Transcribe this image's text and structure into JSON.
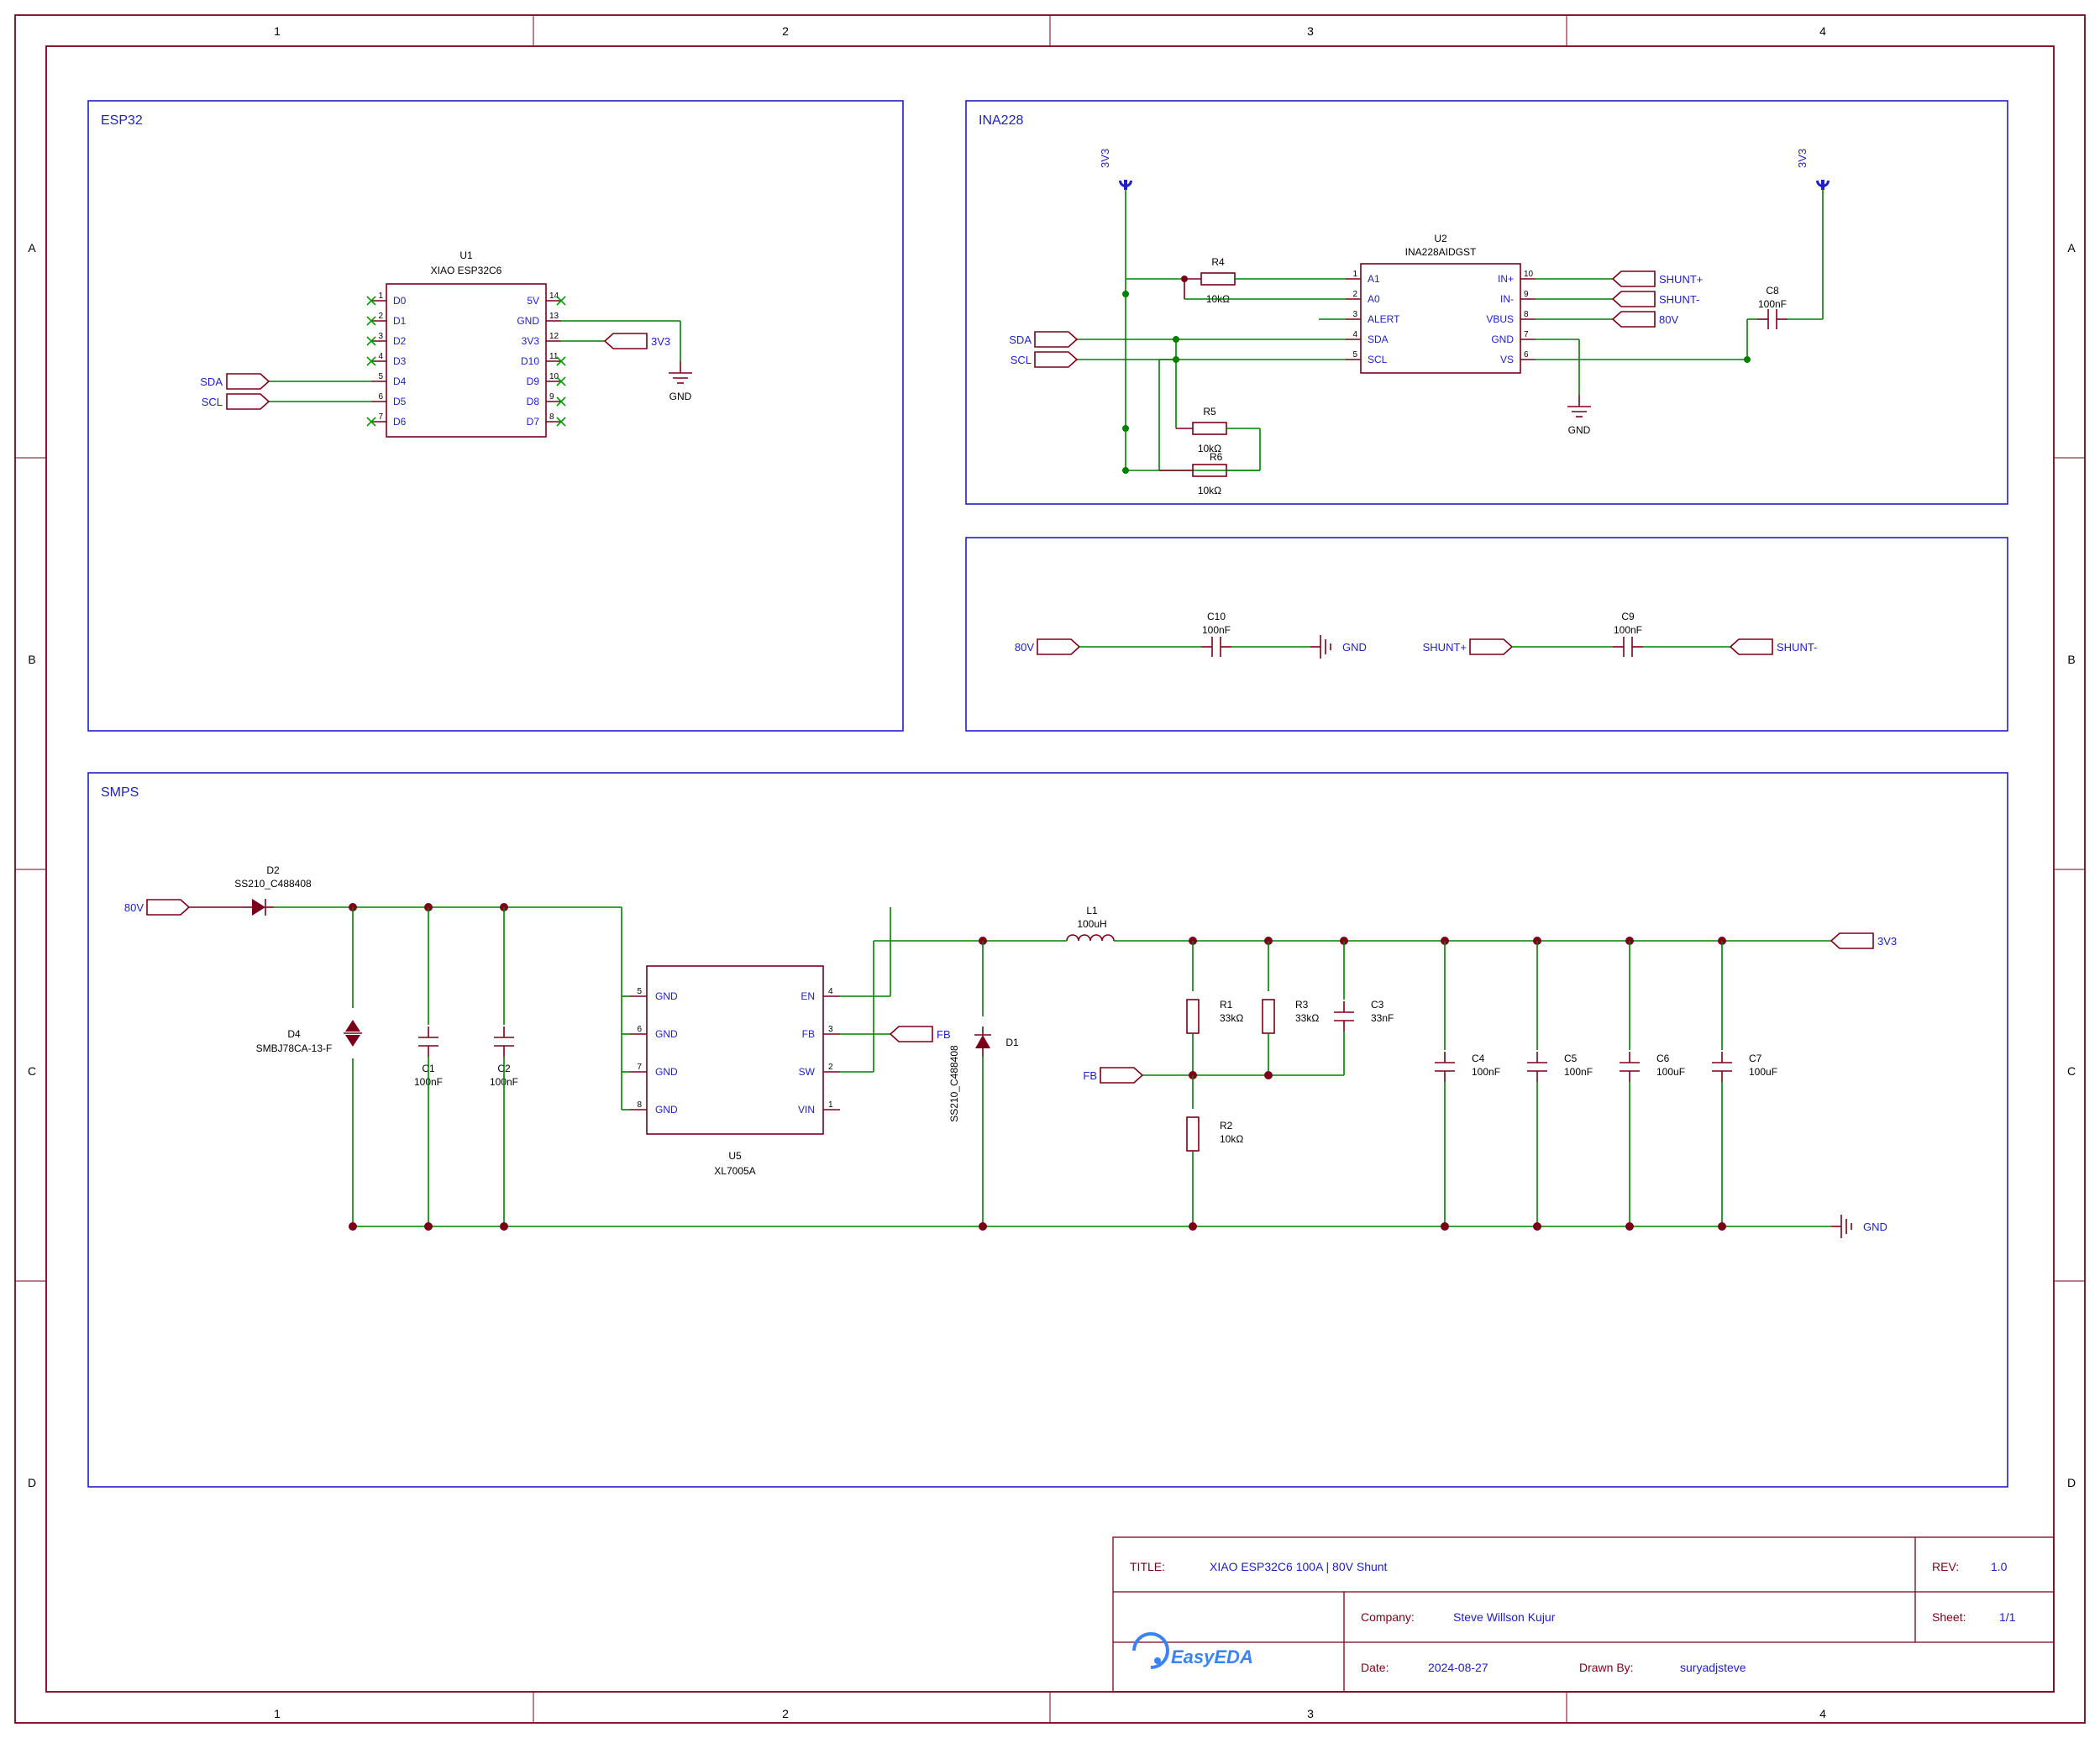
{
  "frame": {
    "cols": [
      "1",
      "2",
      "3",
      "4"
    ],
    "rows": [
      "A",
      "B",
      "C",
      "D"
    ]
  },
  "title_block": {
    "title_label": "TITLE:",
    "title": "XIAO ESP32C6 100A | 80V Shunt",
    "rev_label": "REV:",
    "rev": "1.0",
    "company_label": "Company:",
    "company": "Steve Willson Kujur",
    "sheet_label": "Sheet:",
    "sheet": "1/1",
    "date_label": "Date:",
    "date": "2024-08-27",
    "drawn_by_label": "Drawn By:",
    "drawn_by": "suryadjsteve",
    "logo": "EasyEDA"
  },
  "blocks": {
    "esp32": {
      "title": "ESP32",
      "ref": "U1",
      "part": "XIAO ESP32C6",
      "pins_left": [
        "D0",
        "D1",
        "D2",
        "D3",
        "D4",
        "D5",
        "D6"
      ],
      "pins_right": [
        "5V",
        "GND",
        "3V3",
        "D10",
        "D9",
        "D8",
        "D7"
      ],
      "nets": {
        "sda": "SDA",
        "scl": "SCL",
        "v33": "3V3",
        "gnd": "GND"
      }
    },
    "ina228": {
      "title": "INA228",
      "ref": "U2",
      "part": "INA228AIDGST",
      "pins_left": [
        "A1",
        "A0",
        "ALERT",
        "SDA",
        "SCL"
      ],
      "pins_right": [
        "IN+",
        "IN-",
        "VBUS",
        "GND",
        "VS"
      ],
      "r4": {
        "ref": "R4",
        "val": "10kΩ"
      },
      "r5": {
        "ref": "R5",
        "val": "10kΩ"
      },
      "r6": {
        "ref": "R6",
        "val": "10kΩ"
      },
      "c8": {
        "ref": "C8",
        "val": "100nF"
      },
      "nets": {
        "sda": "SDA",
        "scl": "SCL",
        "v33": "3V3",
        "gnd": "GND",
        "shuntp": "SHUNT+",
        "shuntm": "SHUNT-",
        "v80": "80V"
      }
    },
    "decouple": {
      "c10": {
        "ref": "C10",
        "val": "100nF"
      },
      "c9": {
        "ref": "C9",
        "val": "100nF"
      },
      "nets": {
        "v80": "80V",
        "gnd": "GND",
        "shuntp": "SHUNT+",
        "shuntm": "SHUNT-"
      }
    },
    "smps": {
      "title": "SMPS",
      "u5": {
        "ref": "U5",
        "part": "XL7005A",
        "pins_left": [
          "GND",
          "GND",
          "GND",
          "GND"
        ],
        "pins_right": [
          "EN",
          "FB",
          "SW",
          "VIN"
        ],
        "nums_left": [
          "5",
          "6",
          "7",
          "8"
        ],
        "nums_right": [
          "4",
          "3",
          "2",
          "1"
        ]
      },
      "d2": {
        "ref": "D2",
        "val": "SS210_C488408"
      },
      "d4": {
        "ref": "D4",
        "val": "SMBJ78CA-13-F"
      },
      "d1": {
        "ref": "D1",
        "val": "SS210_C488408"
      },
      "l1": {
        "ref": "L1",
        "val": "100uH"
      },
      "c1": {
        "ref": "C1",
        "val": "100nF"
      },
      "c2": {
        "ref": "C2",
        "val": "100nF"
      },
      "c3": {
        "ref": "C3",
        "val": "33nF"
      },
      "c4": {
        "ref": "C4",
        "val": "100nF"
      },
      "c5": {
        "ref": "C5",
        "val": "100nF"
      },
      "c6": {
        "ref": "C6",
        "val": "100uF"
      },
      "c7": {
        "ref": "C7",
        "val": "100uF"
      },
      "r1": {
        "ref": "R1",
        "val": "33kΩ"
      },
      "r2": {
        "ref": "R2",
        "val": "10kΩ"
      },
      "r3": {
        "ref": "R3",
        "val": "33kΩ"
      },
      "nets": {
        "v80": "80V",
        "fb": "FB",
        "v33": "3V3",
        "gnd": "GND"
      }
    }
  }
}
